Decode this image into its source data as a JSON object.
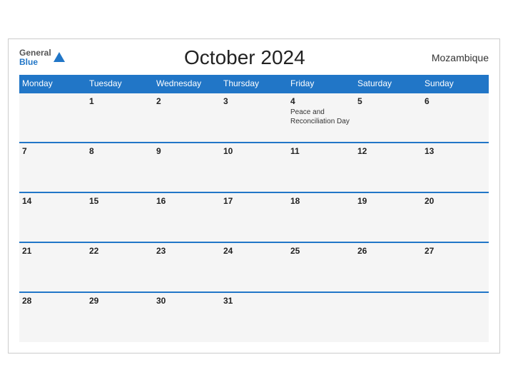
{
  "header": {
    "logo_general": "General",
    "logo_blue": "Blue",
    "title": "October 2024",
    "country": "Mozambique"
  },
  "weekdays": [
    "Monday",
    "Tuesday",
    "Wednesday",
    "Thursday",
    "Friday",
    "Saturday",
    "Sunday"
  ],
  "weeks": [
    [
      {
        "day": "",
        "event": ""
      },
      {
        "day": "1",
        "event": ""
      },
      {
        "day": "2",
        "event": ""
      },
      {
        "day": "3",
        "event": ""
      },
      {
        "day": "4",
        "event": "Peace and\nReconciliation Day"
      },
      {
        "day": "5",
        "event": ""
      },
      {
        "day": "6",
        "event": ""
      }
    ],
    [
      {
        "day": "7",
        "event": ""
      },
      {
        "day": "8",
        "event": ""
      },
      {
        "day": "9",
        "event": ""
      },
      {
        "day": "10",
        "event": ""
      },
      {
        "day": "11",
        "event": ""
      },
      {
        "day": "12",
        "event": ""
      },
      {
        "day": "13",
        "event": ""
      }
    ],
    [
      {
        "day": "14",
        "event": ""
      },
      {
        "day": "15",
        "event": ""
      },
      {
        "day": "16",
        "event": ""
      },
      {
        "day": "17",
        "event": ""
      },
      {
        "day": "18",
        "event": ""
      },
      {
        "day": "19",
        "event": ""
      },
      {
        "day": "20",
        "event": ""
      }
    ],
    [
      {
        "day": "21",
        "event": ""
      },
      {
        "day": "22",
        "event": ""
      },
      {
        "day": "23",
        "event": ""
      },
      {
        "day": "24",
        "event": ""
      },
      {
        "day": "25",
        "event": ""
      },
      {
        "day": "26",
        "event": ""
      },
      {
        "day": "27",
        "event": ""
      }
    ],
    [
      {
        "day": "28",
        "event": ""
      },
      {
        "day": "29",
        "event": ""
      },
      {
        "day": "30",
        "event": ""
      },
      {
        "day": "31",
        "event": ""
      },
      {
        "day": "",
        "event": ""
      },
      {
        "day": "",
        "event": ""
      },
      {
        "day": "",
        "event": ""
      }
    ]
  ]
}
